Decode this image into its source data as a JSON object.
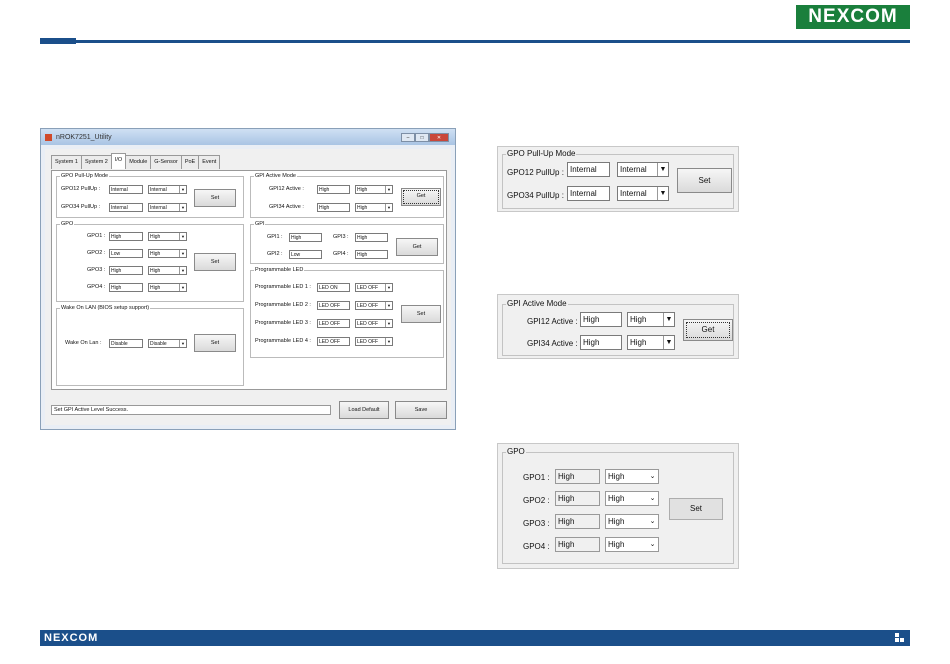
{
  "brand": {
    "logo": "NEXCOM",
    "footer_logo": "NEXCOM"
  },
  "app": {
    "title": "nROK7251_Utility",
    "tabs": [
      "System 1",
      "System 2",
      "I/O",
      "Module",
      "G-Sensor",
      "PoE",
      "Event"
    ],
    "active_tab": "I/O",
    "gpo_pullup": {
      "caption": "GPO Pull-Up Mode",
      "rows": [
        {
          "label": "GPO12 PullUp :",
          "value": "Internal",
          "select": "Internal"
        },
        {
          "label": "GPO34 PullUp :",
          "value": "Internal",
          "select": "Internal"
        }
      ],
      "button": "Set"
    },
    "gpi_active": {
      "caption": "GPI Active Mode",
      "rows": [
        {
          "label": "GPI12 Active :",
          "value": "High",
          "select": "High"
        },
        {
          "label": "GPI34 Active :",
          "value": "High",
          "select": "High"
        }
      ],
      "button": "Get"
    },
    "gpo": {
      "caption": "GPO",
      "rows": [
        {
          "label": "GPO1 :",
          "value": "High",
          "select": "High"
        },
        {
          "label": "GPO2 :",
          "value": "Low",
          "select": "High"
        },
        {
          "label": "GPO3 :",
          "value": "High",
          "select": "High"
        },
        {
          "label": "GPO4 :",
          "value": "High",
          "select": "High"
        }
      ],
      "button": "Set"
    },
    "gpi": {
      "caption": "GPI",
      "items": [
        {
          "label": "GPI1 :",
          "value": "High"
        },
        {
          "label": "GPI3 :",
          "value": "High"
        },
        {
          "label": "GPI2 :",
          "value": "Low"
        },
        {
          "label": "GPI4 :",
          "value": "High"
        }
      ],
      "button": "Get"
    },
    "wol": {
      "caption": "Wake On LAN (BIOS setup support)",
      "label": "Wake On Lan :",
      "value": "Disable",
      "select": "Disable",
      "button": "Set"
    },
    "led": {
      "caption": "Programmable LED",
      "rows": [
        {
          "label": "Programmable LED 1 :",
          "value": "LED ON",
          "select": "LED OFF"
        },
        {
          "label": "Programmable LED 2 :",
          "value": "LED OFF",
          "select": "LED OFF"
        },
        {
          "label": "Programmable LED 3 :",
          "value": "LED OFF",
          "select": "LED OFF"
        },
        {
          "label": "Programmable LED 4 :",
          "value": "LED OFF",
          "select": "LED OFF"
        }
      ],
      "button": "Set"
    },
    "status": "Set GPI Active Level Success.",
    "load_default": "Load Default",
    "save": "Save"
  },
  "zoom_pullup": {
    "caption": "GPO Pull-Up Mode",
    "rows": [
      {
        "label": "GPO12 PullUp :",
        "value": "Internal",
        "select": "Internal"
      },
      {
        "label": "GPO34 PullUp :",
        "value": "Internal",
        "select": "Internal"
      }
    ],
    "button": "Set"
  },
  "zoom_gpi_active": {
    "caption": "GPI Active Mode",
    "rows": [
      {
        "label": "GPI12 Active :",
        "value": "High",
        "select": "High"
      },
      {
        "label": "GPI34 Active :",
        "value": "High",
        "select": "High"
      }
    ],
    "button": "Get"
  },
  "zoom_gpo": {
    "caption": "GPO",
    "rows": [
      {
        "label": "GPO1 :",
        "value": "High",
        "select": "High"
      },
      {
        "label": "GPO2 :",
        "value": "High",
        "select": "High"
      },
      {
        "label": "GPO3 :",
        "value": "High",
        "select": "High"
      },
      {
        "label": "GPO4 :",
        "value": "High",
        "select": "High"
      }
    ],
    "button": "Set"
  }
}
